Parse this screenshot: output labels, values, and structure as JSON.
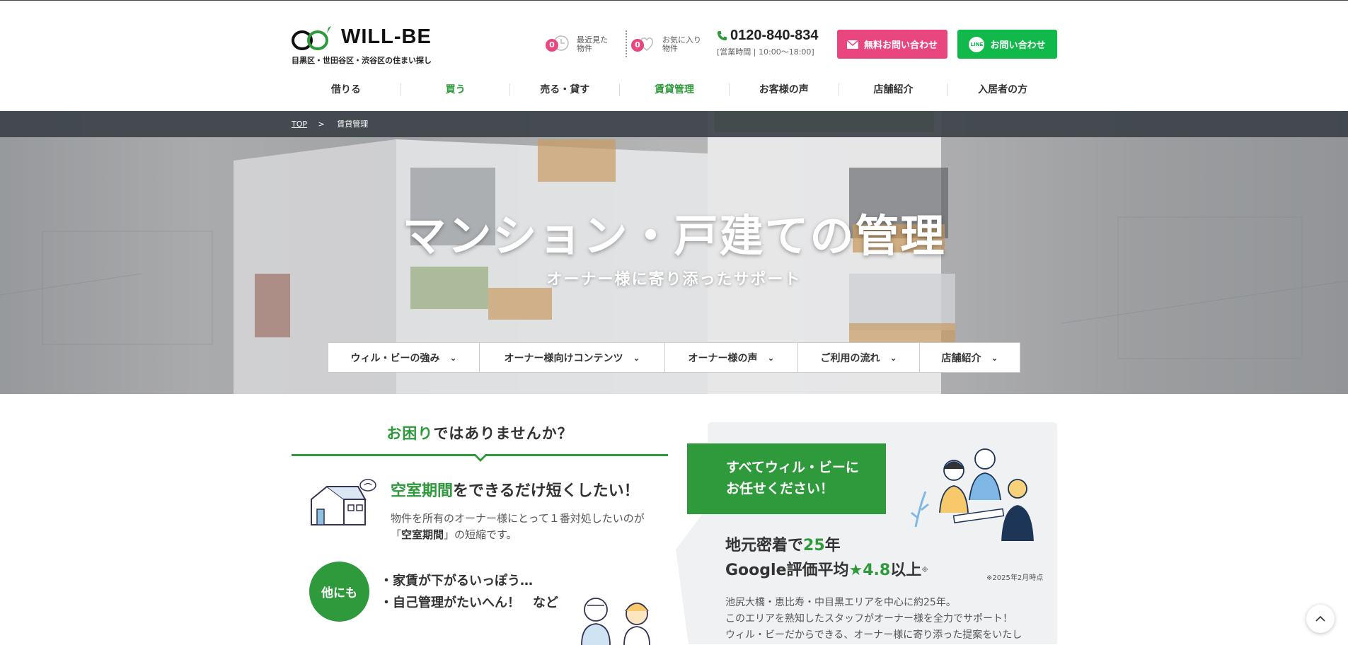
{
  "header": {
    "logo_text": "WILL-BE",
    "tagline": "目黒区・世田谷区・渋谷区の住まい探し",
    "recent": {
      "count": "0",
      "label_line1": "最近見た",
      "label_line2": "物件"
    },
    "favorites": {
      "count": "0",
      "label_line1": "お気に入り",
      "label_line2": "物件"
    },
    "phone": "0120-840-834",
    "hours": "[営業時間 | 10:00〜18:00]",
    "mail_button": "無料お問い合わせ",
    "line_button": "お問い合わせ",
    "line_icon_text": "LINE"
  },
  "nav": {
    "items": [
      {
        "label": "借りる"
      },
      {
        "label": "買う"
      },
      {
        "label": "売る・貸す"
      },
      {
        "label": "賃貸管理"
      },
      {
        "label": "お客様の声"
      },
      {
        "label": "店舗紹介"
      },
      {
        "label": "入居者の方"
      }
    ]
  },
  "breadcrumb": {
    "top": "TOP",
    "separator": ">",
    "current": "賃貸管理"
  },
  "hero": {
    "title": "マンション・戸建ての管理",
    "subtitle": "オーナー様に寄り添ったサポート"
  },
  "subnav": {
    "items": [
      {
        "label": "ウィル・ビーの強み"
      },
      {
        "label": "オーナー様向けコンテンツ"
      },
      {
        "label": "オーナー様の声"
      },
      {
        "label": "ご利用の流れ"
      },
      {
        "label": "店舗紹介"
      }
    ]
  },
  "trouble": {
    "heading_green": "お困り",
    "heading_rest": "ではありませんか？",
    "q1_green": "空室期間",
    "q1_rest": "をできるだけ短くしたい！",
    "q1_desc_before": "物件を所有のオーナー様にとって１番対処したいのが「",
    "q1_desc_bold": "空室期間",
    "q1_desc_after": "」の短縮です。",
    "other_badge": "他にも",
    "other_items": [
      "・家賃が下がるいっぽう…",
      "・自己管理がたいへん！　など"
    ]
  },
  "panel": {
    "ribbon_line1": "すべてウィル・ビーに",
    "ribbon_line2": "お任せください！",
    "local_1": "地元密着で",
    "local_years": "25",
    "local_2": "年",
    "google_1": "Google評価平均",
    "google_star": "★4.8",
    "google_2": "以上",
    "google_mark": "※",
    "note": "※2025年2月時点",
    "desc_lines": [
      "池尻大橋・恵比寿・中目黒エリアを中心に約25年。",
      "このエリアを熟知したスタッフがオーナー様を全力でサポート！",
      "ウィル・ビーだからできる、オーナー様に寄り添った提案をいたし"
    ]
  },
  "colors": {
    "green": "#2e9a3c",
    "pink": "#e94680",
    "line_green": "#11b84a",
    "breadcrumb_bg": "#3c4248"
  }
}
